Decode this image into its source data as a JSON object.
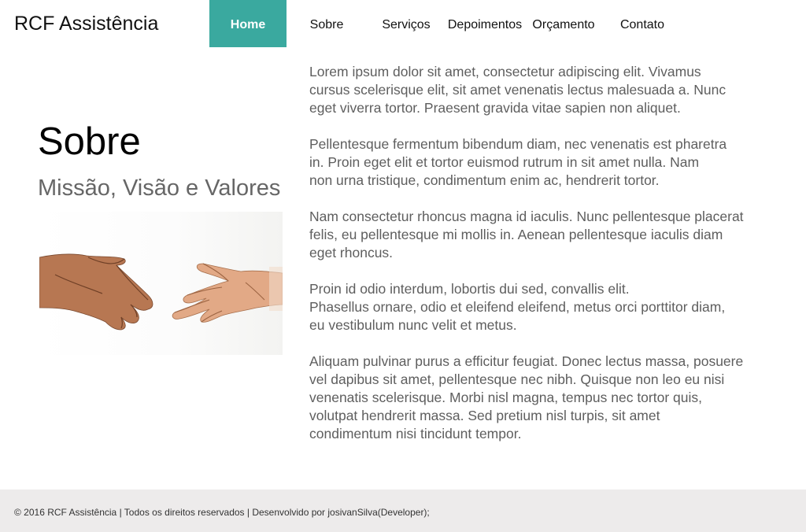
{
  "header": {
    "brand": "RCF Assistência",
    "nav": [
      {
        "label": "Home",
        "active": true
      },
      {
        "label": "Sobre",
        "active": false
      },
      {
        "label": "Serviços",
        "active": false
      },
      {
        "label": "Depoimentos",
        "active": false
      },
      {
        "label": "Orçamento",
        "active": false
      },
      {
        "label": "Contato",
        "active": false
      }
    ]
  },
  "about": {
    "title": "Sobre",
    "subtitle": "Missão, Visão e Valores",
    "image": {
      "icon": "handshake-icon"
    }
  },
  "content": {
    "paragraphs": [
      "Lorem ipsum dolor sit amet, consectetur adipiscing elit. Vivamus\ncursus scelerisque elit, sit amet venenatis lectus malesuada a. Nunc\neget viverra tortor. Praesent gravida vitae sapien non aliquet.",
      "Pellentesque fermentum bibendum diam, nec venenatis est pharetra\n in. Proin eget elit et tortor euismod rutrum in sit amet nulla. Nam\nnon urna tristique, condimentum enim ac, hendrerit tortor.",
      "Nam consectetur rhoncus magna id iaculis. Nunc pellentesque placerat\n felis, eu pellentesque mi mollis in. Aenean pellentesque iaculis diam\n eget rhoncus.",
      "Proin id odio interdum, lobortis dui sed, convallis elit.\nPhasellus ornare, odio et eleifend eleifend, metus orci porttitor diam,\neu vestibulum nunc velit et metus.",
      "Aliquam pulvinar purus a efficitur feugiat. Donec lectus massa, posuere\nvel dapibus sit amet, pellentesque nec nibh. Quisque non leo eu nisi\nvenenatis scelerisque. Morbi nisl magna, tempus nec tortor quis,\nvolutpat hendrerit massa. Sed pretium nisl turpis, sit amet\ncondimentum nisi tincidunt tempor."
    ]
  },
  "footer": {
    "text": "© 2016 RCF Assistência | Todos os direitos reservados | Desenvolvido por josivanSilva(Developer);"
  },
  "colors": {
    "accent": "#3aa99f",
    "body_text": "#5e5e5e",
    "footer_bg": "#edebeb"
  }
}
